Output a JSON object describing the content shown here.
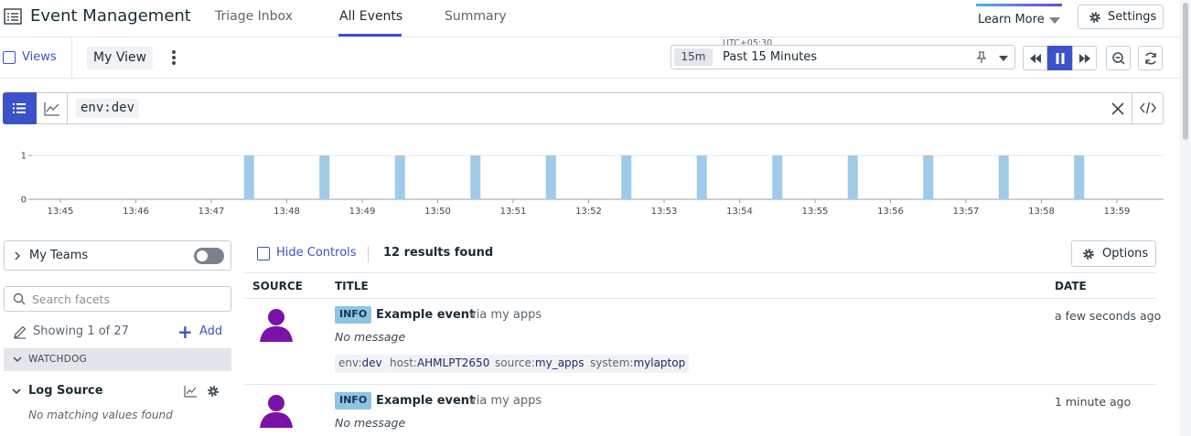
{
  "app": {
    "title": "Event Management"
  },
  "tabs": [
    {
      "label": "Triage Inbox",
      "active": false
    },
    {
      "label": "All Events",
      "active": true
    },
    {
      "label": "Summary",
      "active": false
    }
  ],
  "header": {
    "learn_more": "Learn More",
    "settings": "Settings"
  },
  "toolbar": {
    "views": "Views",
    "view_name": "My View"
  },
  "timepicker": {
    "timezone": "UTC+05:30",
    "badge": "15m",
    "label": "Past 15 Minutes"
  },
  "search": {
    "query_key": "env",
    "query_value": "dev"
  },
  "histogram": {
    "y_ticks": [
      "1",
      "0"
    ],
    "x_ticks": [
      "13:45",
      "13:46",
      "13:47",
      "13:48",
      "13:49",
      "13:50",
      "13:51",
      "13:52",
      "13:53",
      "13:54",
      "13:55",
      "13:56",
      "13:57",
      "13:58",
      "13:59"
    ]
  },
  "chart_data": {
    "type": "bar",
    "x": [
      "13:47:30",
      "13:48:30",
      "13:49:30",
      "13:50:30",
      "13:51:30",
      "13:52:30",
      "13:53:30",
      "13:54:30",
      "13:55:30",
      "13:56:30",
      "13:57:30",
      "13:58:30"
    ],
    "values": [
      1,
      1,
      1,
      1,
      1,
      1,
      1,
      1,
      1,
      1,
      1,
      1
    ],
    "ylim": [
      0,
      1
    ],
    "bar_color": "#9fcbe8",
    "grid": true
  },
  "facets": {
    "my_teams": "My Teams",
    "search_placeholder": "Search facets",
    "showing": "Showing 1 of 27",
    "add": "Add",
    "group": "WATCHDOG",
    "facet_name": "Log Source",
    "facet_empty": "No matching values found"
  },
  "results": {
    "hide_controls": "Hide Controls",
    "count": "12 results found",
    "options": "Options",
    "columns": {
      "source": "SOURCE",
      "title": "TITLE",
      "date": "DATE"
    },
    "rows": [
      {
        "status": "INFO",
        "title": "Example event",
        "via": "via my apps",
        "message": "No message",
        "date": "a few seconds ago",
        "tags": [
          {
            "key": "env",
            "value": "dev"
          },
          {
            "key": "host",
            "value": "AHMLPT2650"
          },
          {
            "key": "source",
            "value": "my_apps"
          },
          {
            "key": "system",
            "value": "mylaptop"
          }
        ]
      },
      {
        "status": "INFO",
        "title": "Example event",
        "via": "via my apps",
        "message": "No message",
        "date": "1 minute ago"
      }
    ]
  },
  "colors": {
    "accent": "#3c52c9",
    "avatar": "#7a12a8",
    "badge": "#8fc4e6"
  }
}
